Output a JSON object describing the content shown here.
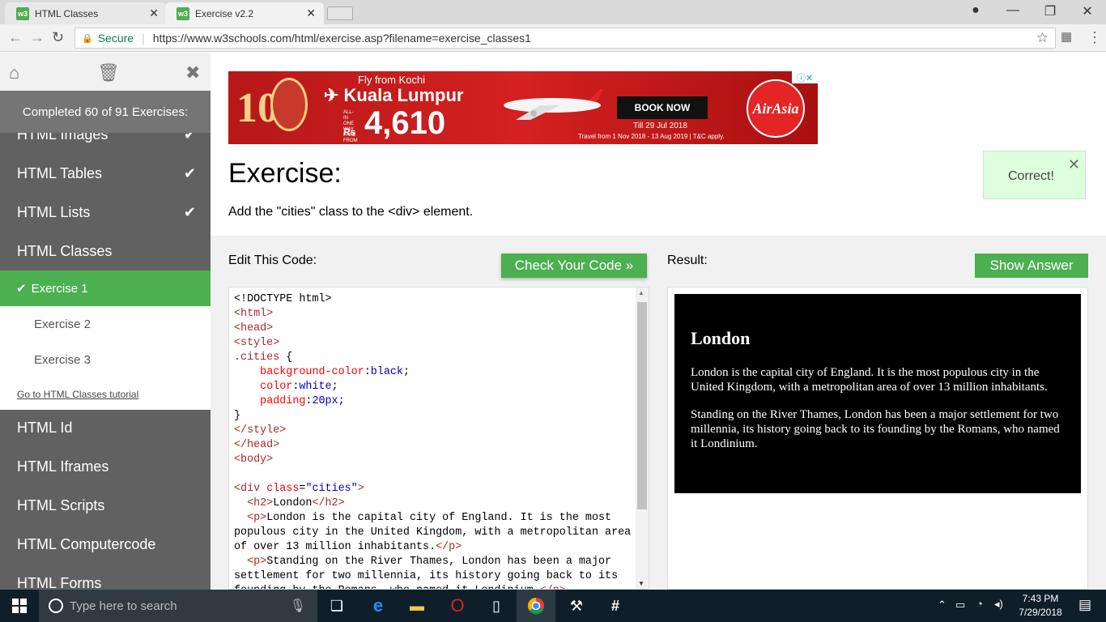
{
  "browser": {
    "tabs": [
      {
        "label": "HTML Classes",
        "favicon": "w3"
      },
      {
        "label": "Exercise v2.2",
        "favicon": "w3"
      }
    ],
    "address": {
      "secure_label": "Secure",
      "url": "https://www.w3schools.com/html/exercise.asp?filename=exercise_classes1"
    }
  },
  "sidebar": {
    "progress": "Completed 60 of 91 Exercises:",
    "chapters_above": [
      {
        "label": "HTML Images",
        "done": true
      },
      {
        "label": "HTML Tables",
        "done": true
      },
      {
        "label": "HTML Lists",
        "done": true
      }
    ],
    "current_chapter": "HTML Classes",
    "exercises": [
      "Exercise 1",
      "Exercise 2",
      "Exercise 3"
    ],
    "tutorial_link": "Go to HTML Classes tutorial",
    "chapters_below": [
      "HTML Id",
      "HTML Iframes",
      "HTML Scripts",
      "HTML Computercode",
      "HTML Forms"
    ]
  },
  "ad": {
    "fly_from": "Fly from Kochi",
    "destination": "Kuala Lumpur",
    "all_in": "ALL-IN ONE WAY FARE FROM",
    "currency": "Rs",
    "price": "4,610",
    "book_now": "BOOK NOW",
    "till": "Till 29 Jul 2018",
    "travel": "Travel from 1 Nov 2018 - 13 Aug 2019 | T&C apply.",
    "brand": "AirAsia",
    "badge": "10"
  },
  "exercise": {
    "title": "Exercise:",
    "task": "Add the \"cities\" class to the <div> element.",
    "correct": "Correct!",
    "edit_label": "Edit This Code:",
    "check_button": "Check Your Code »",
    "result_label": "Result:",
    "answer_button": "Show Answer"
  },
  "result": {
    "heading": "London",
    "p1": "London is the capital city of England. It is the most populous city in the United Kingdom, with a metropolitan area of over 13 million inhabitants.",
    "p2": "Standing on the River Thames, London has been a major settlement for two millennia, its history going back to its founding by the Romans, who named it Londinium."
  },
  "taskbar": {
    "search_placeholder": "Type here to search",
    "time": "7:43 PM",
    "date": "7/29/2018"
  }
}
